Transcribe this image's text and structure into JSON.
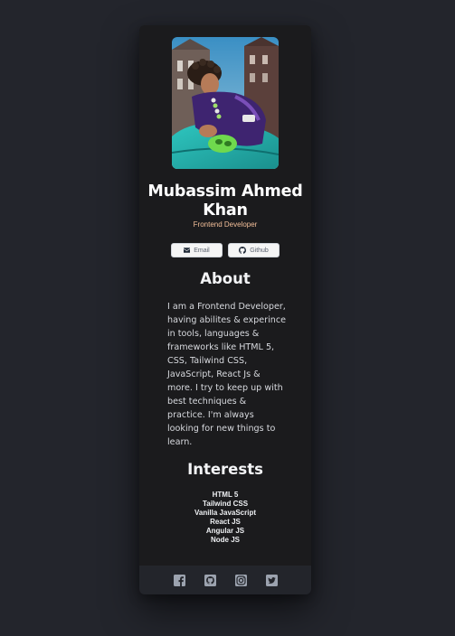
{
  "profile": {
    "name": "Mubassim Ahmed Khan",
    "role": "Frontend Developer"
  },
  "buttons": {
    "email_label": "Email",
    "github_label": "Github"
  },
  "about": {
    "title": "About",
    "text": "I am a Frontend Developer, having abilites & experince in tools, languages & frameworks like HTML 5, CSS, Tailwind CSS, JavaScript, React Js & more. I try to keep up with best techniques & practice. I'm always looking for new things to learn."
  },
  "interests": {
    "title": "Interests",
    "items": [
      "HTML 5",
      "Tailwind CSS",
      "Vanilla JavaScript",
      "React JS",
      "Angular JS",
      "Node JS"
    ]
  },
  "footer": {
    "icons": [
      "facebook-icon",
      "github-icon",
      "instagram-icon",
      "twitter-icon"
    ]
  },
  "colors": {
    "page_background": "#23252c",
    "card_background": "#1b1b1d",
    "footer_background": "#23252b",
    "role_accent": "#f3bf99",
    "icon_color": "#9ca3af"
  }
}
